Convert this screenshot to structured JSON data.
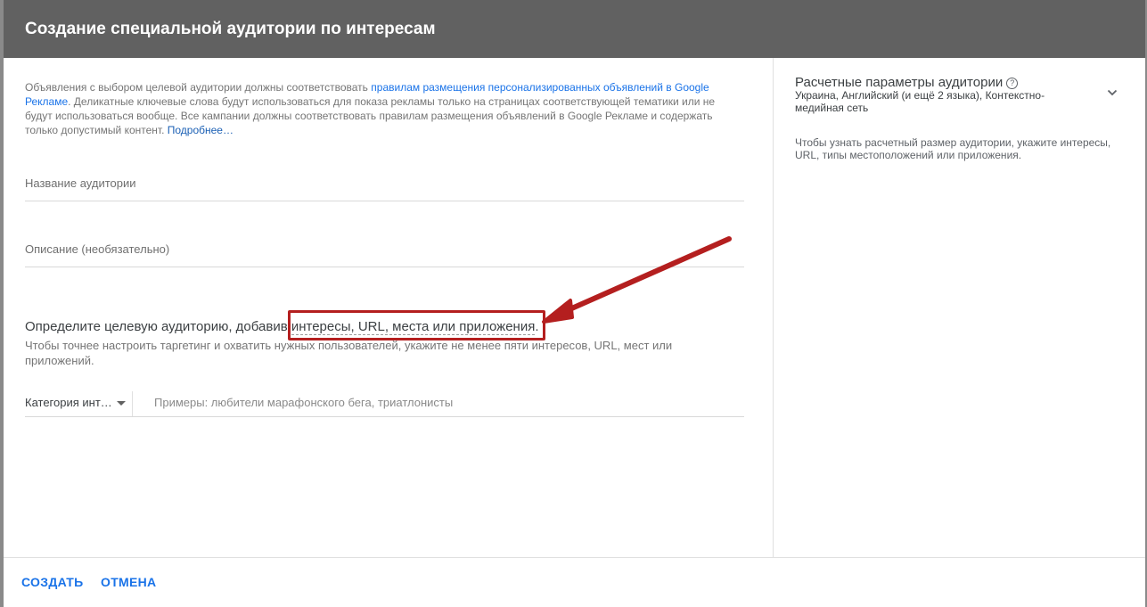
{
  "dialog": {
    "title": "Создание специальной аудитории по интересам"
  },
  "notice": {
    "text_1": "Объявления с выбором целевой аудитории должны соответствовать ",
    "link_policy": "правилам размещения персонализированных объявлений в Google Рекламе",
    "text_2": ". Деликатные ключевые слова будут использоваться для показа рекламы только на страницах соответствующей тематики или не будут использоваться вообще. Все кампании должны соответствовать правилам размещения объявлений в Google Рекламе и содержать только допустимый контент. ",
    "link_more": "Подробнее…"
  },
  "form": {
    "name_placeholder": "Название аудитории",
    "description_placeholder": "Описание (необязательно)"
  },
  "targeting": {
    "title_prefix": "Определите целевую аудиторию, добавив ",
    "title_link": "интересы, URL, места или приложения",
    "title_suffix": ".",
    "subtitle": "Чтобы точнее настроить таргетинг и охватить нужных пользователей, укажите не менее пяти интересов, URL, мест или приложений.",
    "category_selected": "Категория инт…",
    "search_placeholder": "Примеры: любители марафонского бега, триатлонисты"
  },
  "side_panel": {
    "title": "Расчетные параметры аудитории",
    "help_icon_glyph": "?",
    "params": "Украина, Английский (и ещё 2 языка), Контекстно-медийная сеть",
    "hint": "Чтобы узнать расчетный размер аудитории, укажите интересы, URL, типы местоположений или приложения."
  },
  "footer": {
    "create_label": "СОЗДАТЬ",
    "cancel_label": "ОТМЕНА"
  },
  "colors": {
    "header_bg": "#616161",
    "accent": "#1a73e8",
    "annotation_red": "#b41f1f"
  },
  "icons": {
    "chevron": "chevron-down-icon",
    "help": "help-circle-icon",
    "dropdown": "dropdown-arrow-icon"
  }
}
